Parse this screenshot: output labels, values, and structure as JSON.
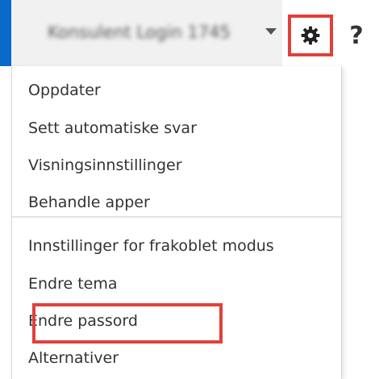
{
  "header": {
    "account_name": "Konsulent Login 1745",
    "help_label": "?"
  },
  "menu": {
    "group_one": [
      {
        "label": "Oppdater"
      },
      {
        "label": "Sett automatiske svar"
      },
      {
        "label": "Visningsinnstillinger"
      },
      {
        "label": "Behandle apper"
      }
    ],
    "group_two": [
      {
        "label": "Innstillinger for frakoblet modus"
      },
      {
        "label": "Endre tema"
      },
      {
        "label": "Endre passord"
      },
      {
        "label": "Alternativer"
      }
    ]
  },
  "colors": {
    "accent": "#0a6ac9",
    "highlight": "#e0413a",
    "text": "#333333"
  },
  "icons": {
    "settings": "gear-icon",
    "account_dropdown": "chevron-down-icon",
    "help": "help-icon"
  }
}
